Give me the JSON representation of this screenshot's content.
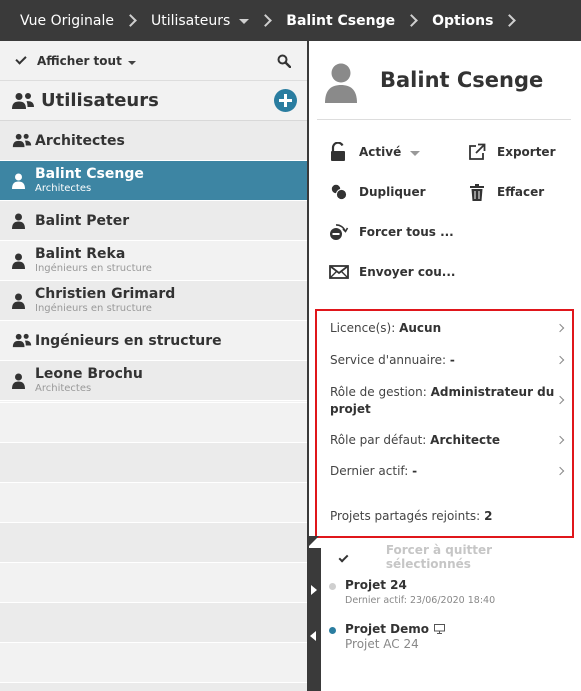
{
  "breadcrumb": {
    "items": [
      "Vue Originale",
      "Utilisateurs",
      "Balint Csenge",
      "Options"
    ]
  },
  "left_panel": {
    "filter_label": "Afficher tout",
    "title": "Utilisateurs",
    "rows": [
      {
        "name": "Architectes",
        "sub": "",
        "type": "group"
      },
      {
        "name": "Balint Csenge",
        "sub": "Architectes",
        "type": "user",
        "selected": true
      },
      {
        "name": "Balint Peter",
        "sub": "",
        "type": "user"
      },
      {
        "name": "Balint Reka",
        "sub": "Ingénieurs en structure",
        "type": "user"
      },
      {
        "name": "Christien Grimard",
        "sub": "Ingénieurs en structure",
        "type": "user"
      },
      {
        "name": "Ingénieurs en structure",
        "sub": "",
        "type": "group"
      },
      {
        "name": "Leone Brochu",
        "sub": "Architectes",
        "type": "user"
      }
    ]
  },
  "right_panel": {
    "profile_name": "Balint Csenge",
    "actions": {
      "active": "Activé",
      "export": "Exporter",
      "duplicate": "Dupliquer",
      "delete": "Effacer",
      "force_all": "Forcer tous ...",
      "send": "Envoyer cou..."
    },
    "properties": {
      "licence_label": "Licence(s):",
      "licence_value": "Aucun",
      "directory_label": "Service d'annuaire:",
      "directory_value": "-",
      "mgmt_role_label": "Rôle de gestion:",
      "mgmt_role_value_1": "Administrateur du",
      "mgmt_role_value_2": "projet",
      "default_role_label": "Rôle par défaut:",
      "default_role_value": "Architecte",
      "last_active_label": "Dernier actif:",
      "last_active_value": "-",
      "shared_projects_label": "Projets partagés rejoints:",
      "shared_projects_value": "2"
    },
    "force_quit_label": "Forcer à quitter sélectionnés",
    "projects": [
      {
        "name": "Projet 24",
        "sub": "Dernier actif: 23/06/2020 18:40"
      },
      {
        "name": "Projet Demo",
        "sub": "Projet AC 24"
      }
    ]
  },
  "colors": {
    "topbar": "#3a3a3a",
    "selected_row": "#3d85a3",
    "accent": "#2a7da0",
    "highlight_border": "#e0161b"
  }
}
